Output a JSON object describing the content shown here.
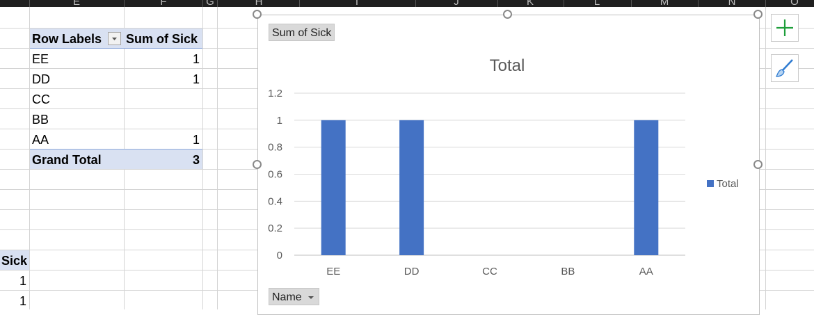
{
  "columns": [
    "E",
    "F",
    "G",
    "H",
    "I",
    "J",
    "K",
    "L",
    "M",
    "N",
    "O"
  ],
  "pivot": {
    "header_labels": "Row Labels",
    "header_sum": "Sum of Sick",
    "rows": [
      {
        "label": "EE",
        "value": "1"
      },
      {
        "label": "DD",
        "value": "1"
      },
      {
        "label": "CC",
        "value": ""
      },
      {
        "label": "BB",
        "value": ""
      },
      {
        "label": "AA",
        "value": "1"
      }
    ],
    "grand_total_label": "Grand Total",
    "grand_total_value": "3"
  },
  "lower_cells": {
    "header": "Sick",
    "values": [
      "1",
      "1"
    ]
  },
  "chart_buttons": {
    "value_field": "Sum of Sick",
    "axis_field": "Name"
  },
  "colors": {
    "bar": "#4472C4",
    "pivot_header": "#d9e1f2",
    "chart_element_plus": "#1e9e3a",
    "brush": "#2e7bd1"
  },
  "chart_data": {
    "type": "bar",
    "title": "Total",
    "categories": [
      "EE",
      "DD",
      "CC",
      "BB",
      "AA"
    ],
    "series": [
      {
        "name": "Total",
        "values": [
          1,
          1,
          0,
          0,
          1
        ]
      }
    ],
    "ylim": [
      0,
      1.2
    ],
    "yticks": [
      "0",
      "0.2",
      "0.4",
      "0.6",
      "0.8",
      "1",
      "1.2"
    ],
    "legend_position": "right",
    "grid": true
  }
}
